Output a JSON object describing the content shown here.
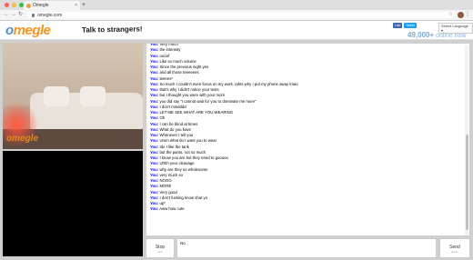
{
  "browser": {
    "tab_title": "Omegle",
    "tab_close": "×",
    "new_tab": "+",
    "url": "omegle.com",
    "back": "←",
    "forward": "→",
    "reload": "↻",
    "bookmark": "☆",
    "menu": "⋮"
  },
  "header": {
    "logo_o": "o",
    "logo_rest": "megle",
    "tagline": "Talk to strangers!",
    "like_label": "Like",
    "tweet_label": "Tweet",
    "language_label": "Select Language ▾",
    "online_count": "49,000+",
    "online_label": " online now"
  },
  "video": {
    "watermark": "omegle"
  },
  "chat": {
    "speaker": "You:",
    "messages": [
      "Very much",
      "the intensity",
      "oooof",
      "Like so much volume",
      "Since the previous night yes",
      "and all those teeeeees",
      "teeees*",
      "So much I couldn't even focus on my work, tahts why I put my phone away lmao",
      "that's why I didn't notice your texts",
      "but I thought you were with your mom",
      "you did say \"I cannot wait for you to dominate me more\"",
      "I don't mindddd",
      "LET ME SEE WHAT ARE YOU WEARING",
      "Oh",
      "I can be blind at times",
      "What do you have",
      "Whenever I tell you",
      "Umm what do I want you to wear",
      "Ido I like the tank",
      "but the pants, not so much",
      "I know you are but they need to gooooo",
      "Uhhh your cleavage",
      "why are they so wholesome",
      "very much so",
      "NOOO",
      "MORE",
      "Very good",
      "I don't fucking know shut yo",
      "up*",
      "Aww how cute"
    ]
  },
  "controls": {
    "stop_label": "Stop",
    "stop_hint": "Esc",
    "message_value": "No",
    "send_label": "Send",
    "send_hint": "Enter"
  },
  "colors": {
    "speaker": "#0000ff",
    "logo_orange": "#f7941d",
    "logo_blue": "#4a90d9"
  }
}
